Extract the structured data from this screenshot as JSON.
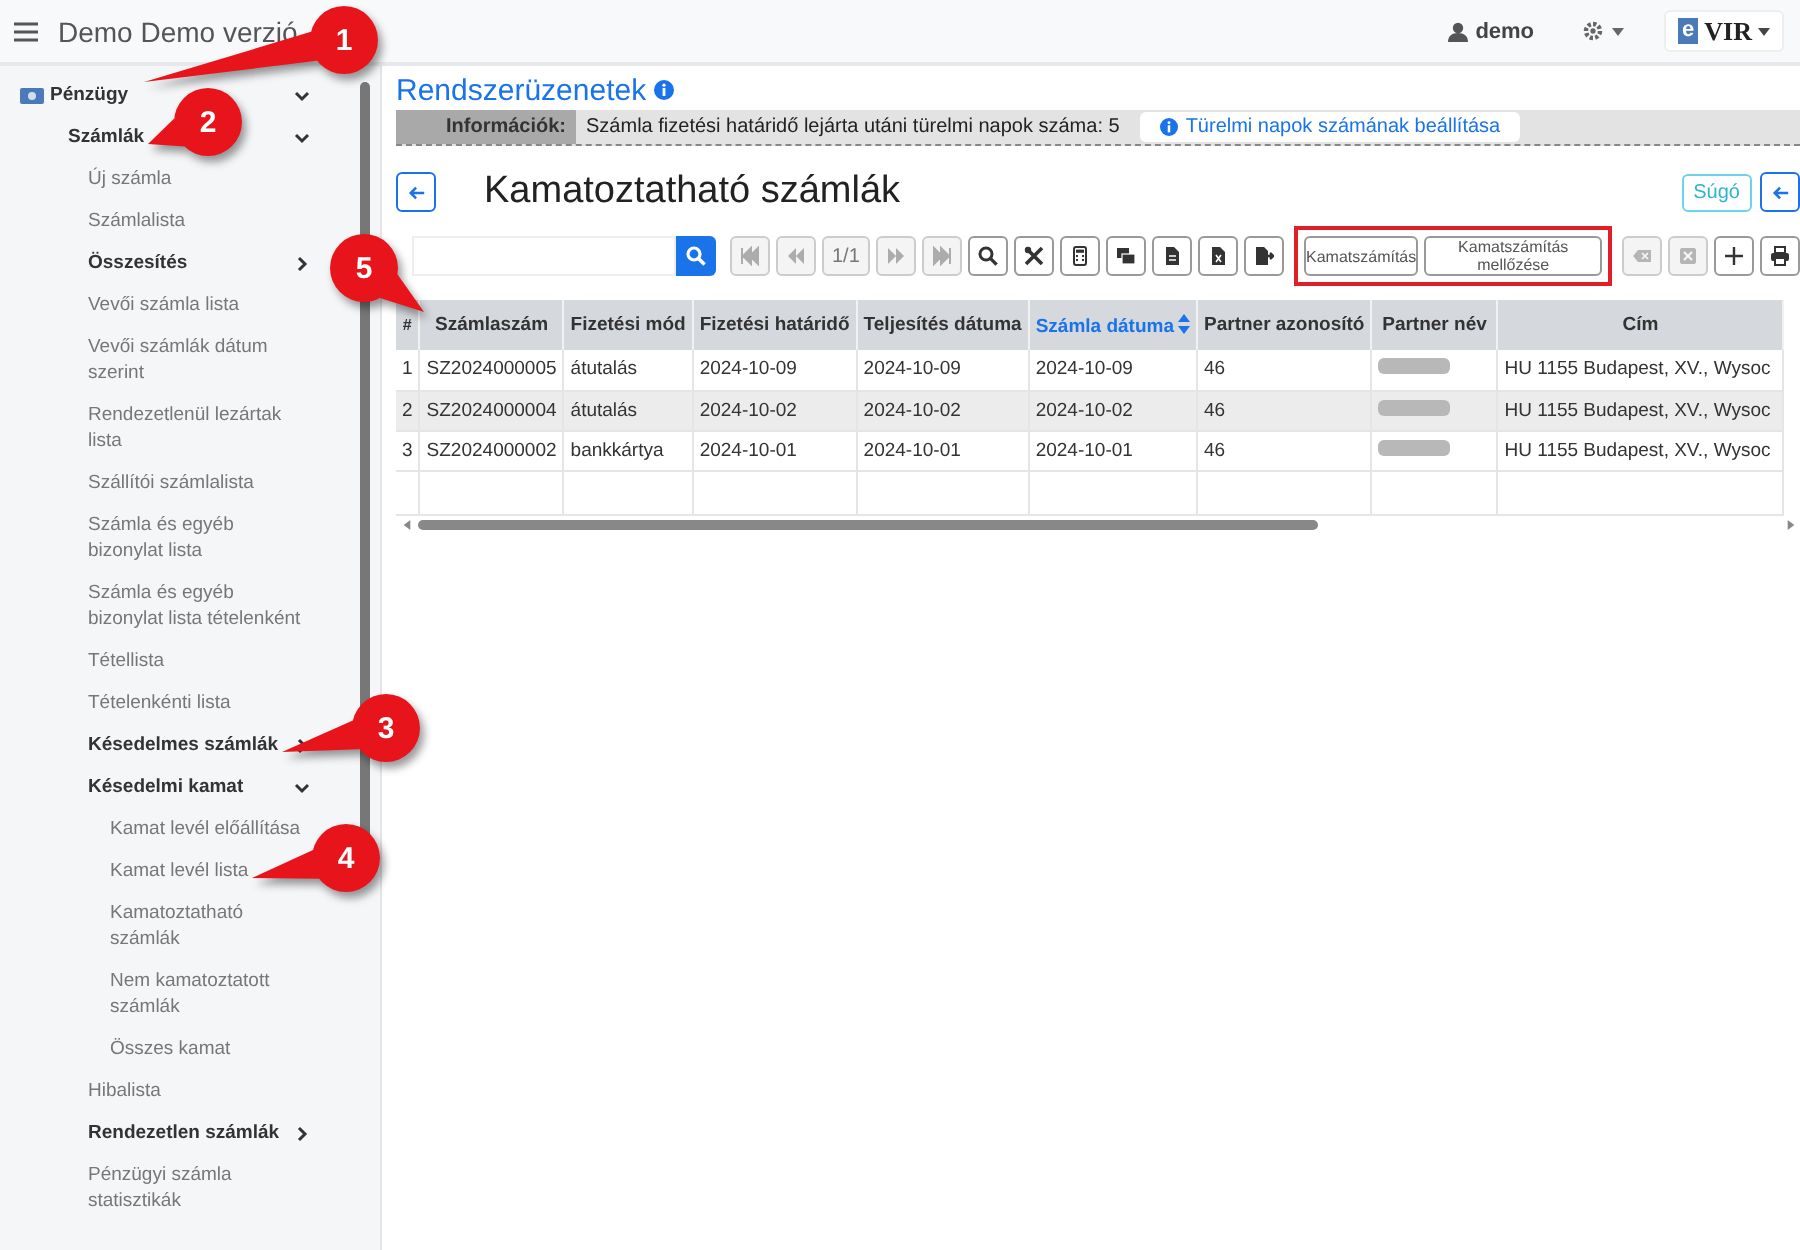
{
  "app_bar": {
    "title": "Demo Demo verzió",
    "user": "demo",
    "brand": {
      "mark": "e",
      "text": "VIR"
    }
  },
  "sidebar": {
    "items": [
      {
        "label": "Pénzügy",
        "kind": "group",
        "expanded": true,
        "children": [
          {
            "label": "Számlák",
            "kind": "group",
            "expanded": true,
            "children": [
              {
                "label": "Új számla",
                "kind": "link"
              },
              {
                "label": "Számlalista",
                "kind": "link"
              },
              {
                "label": "Összesítés",
                "kind": "group",
                "expanded": false
              },
              {
                "label": "Vevői számla lista",
                "kind": "link"
              },
              {
                "label": "Vevői számlák dátum szerint",
                "kind": "link"
              },
              {
                "label": "Rendezetlenül lezártak lista",
                "kind": "link"
              },
              {
                "label": "Szállítói számlalista",
                "kind": "link"
              },
              {
                "label": "Számla és egyéb bizonylat lista",
                "kind": "link"
              },
              {
                "label": "Számla és egyéb bizonylat lista tételenként",
                "kind": "link"
              },
              {
                "label": "Tétellista",
                "kind": "link"
              },
              {
                "label": "Tételenkénti lista",
                "kind": "link"
              },
              {
                "label": "Késedelmes számlák",
                "kind": "group",
                "expanded": false
              },
              {
                "label": "Késedelmi kamat",
                "kind": "group",
                "expanded": true,
                "children": [
                  {
                    "label": "Kamat levél előállítása",
                    "kind": "link"
                  },
                  {
                    "label": "Kamat levél lista",
                    "kind": "link"
                  },
                  {
                    "label": "Kamatoztatható számlák",
                    "kind": "link"
                  },
                  {
                    "label": "Nem kamatoztatott számlák",
                    "kind": "link"
                  },
                  {
                    "label": "Összes kamat",
                    "kind": "link"
                  }
                ]
              },
              {
                "label": "Hibalista",
                "kind": "link"
              },
              {
                "label": "Rendezetlen számlák",
                "kind": "group",
                "expanded": false
              },
              {
                "label": "Pénzügyi számla statisztikák",
                "kind": "link"
              }
            ]
          }
        ]
      }
    ]
  },
  "messages": {
    "title": "Rendszerüzenetek",
    "label": "Információk:",
    "text": "Számla fizetési határidő lejárta utáni türelmi napok száma: 5",
    "action": "Türelmi napok számának beállítása"
  },
  "page": {
    "title": "Kamatoztatható számlák",
    "help": "Súgó"
  },
  "toolbar": [
    {
      "kind": "first",
      "disabled": true
    },
    {
      "kind": "prev",
      "disabled": true
    },
    {
      "kind": "page",
      "label": "1/1",
      "disabled": true
    },
    {
      "kind": "next",
      "disabled": true
    },
    {
      "kind": "last",
      "disabled": true
    },
    {
      "kind": "search",
      "disabled": false
    },
    {
      "kind": "tools",
      "disabled": false
    },
    {
      "kind": "calculator",
      "disabled": false
    },
    {
      "kind": "stack",
      "disabled": false
    },
    {
      "kind": "document",
      "disabled": false
    },
    {
      "kind": "spreadsheet",
      "disabled": false
    },
    {
      "kind": "export",
      "disabled": false
    },
    {
      "kind": "text",
      "label": "Kamatszámítás",
      "disabled": false,
      "highlighted": true
    },
    {
      "kind": "text",
      "label": "Kamatszámítás mellőzése",
      "disabled": false,
      "highlighted": true
    },
    {
      "kind": "erase",
      "disabled": true
    },
    {
      "kind": "cancel",
      "disabled": true
    },
    {
      "kind": "add",
      "disabled": false
    },
    {
      "kind": "print",
      "disabled": false
    }
  ],
  "table": {
    "columns": [
      {
        "label": "#",
        "sorted": false
      },
      {
        "label": "Számlaszám",
        "sorted": false
      },
      {
        "label": "Fizetési mód",
        "sorted": false
      },
      {
        "label": "Fizetési határidő",
        "sorted": false
      },
      {
        "label": "Teljesítés dátuma",
        "sorted": false
      },
      {
        "label": "Számla dátuma",
        "sorted": true
      },
      {
        "label": "Partner azonosító",
        "sorted": false
      },
      {
        "label": "Partner név",
        "sorted": false
      },
      {
        "label": "Cím",
        "sorted": false
      }
    ],
    "rows": [
      [
        "1",
        "SZ2024000005",
        "átutalás",
        "2024-10-09",
        "2024-10-09",
        "2024-10-09",
        "46",
        null,
        "HU 1155 Budapest, XV., Wysoc"
      ],
      [
        "2",
        "SZ2024000004",
        "átutalás",
        "2024-10-02",
        "2024-10-02",
        "2024-10-02",
        "46",
        null,
        "HU 1155 Budapest, XV., Wysoc"
      ],
      [
        "3",
        "SZ2024000002",
        "bankkártya",
        "2024-10-01",
        "2024-10-01",
        "2024-10-01",
        "46",
        null,
        "HU 1155 Budapest, XV., Wysoc"
      ]
    ]
  },
  "callouts": [
    "1",
    "2",
    "3",
    "4",
    "5"
  ]
}
